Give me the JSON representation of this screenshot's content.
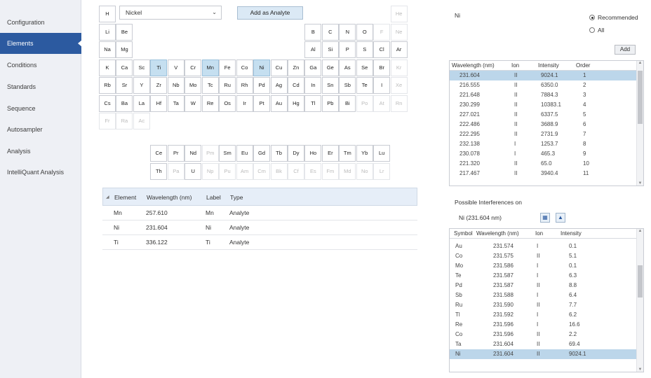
{
  "sidebar": {
    "items": [
      {
        "label": "Configuration",
        "active": false
      },
      {
        "label": "Elements",
        "active": true
      },
      {
        "label": "Conditions",
        "active": false
      },
      {
        "label": "Standards",
        "active": false
      },
      {
        "label": "Sequence",
        "active": false
      },
      {
        "label": "Autosampler",
        "active": false
      },
      {
        "label": "Analysis",
        "active": false
      },
      {
        "label": "IntelliQuant Analysis",
        "active": false
      }
    ]
  },
  "element_picker": {
    "selected": "Nickel",
    "add_button": "Add as Analyte"
  },
  "periodic_table": [
    {
      "s": "H",
      "r": 0,
      "c": 0
    },
    {
      "s": "He",
      "r": 0,
      "c": 17,
      "d": true
    },
    {
      "s": "Li",
      "r": 1,
      "c": 0
    },
    {
      "s": "Be",
      "r": 1,
      "c": 1
    },
    {
      "s": "B",
      "r": 1,
      "c": 12
    },
    {
      "s": "C",
      "r": 1,
      "c": 13
    },
    {
      "s": "N",
      "r": 1,
      "c": 14
    },
    {
      "s": "O",
      "r": 1,
      "c": 15
    },
    {
      "s": "F",
      "r": 1,
      "c": 16,
      "d": true
    },
    {
      "s": "Ne",
      "r": 1,
      "c": 17,
      "d": true
    },
    {
      "s": "Na",
      "r": 2,
      "c": 0
    },
    {
      "s": "Mg",
      "r": 2,
      "c": 1
    },
    {
      "s": "Al",
      "r": 2,
      "c": 12
    },
    {
      "s": "Si",
      "r": 2,
      "c": 13
    },
    {
      "s": "P",
      "r": 2,
      "c": 14
    },
    {
      "s": "S",
      "r": 2,
      "c": 15
    },
    {
      "s": "Cl",
      "r": 2,
      "c": 16
    },
    {
      "s": "Ar",
      "r": 2,
      "c": 17
    },
    {
      "s": "K",
      "r": 3,
      "c": 0
    },
    {
      "s": "Ca",
      "r": 3,
      "c": 1
    },
    {
      "s": "Sc",
      "r": 3,
      "c": 2
    },
    {
      "s": "Ti",
      "r": 3,
      "c": 3,
      "sel": true
    },
    {
      "s": "V",
      "r": 3,
      "c": 4
    },
    {
      "s": "Cr",
      "r": 3,
      "c": 5
    },
    {
      "s": "Mn",
      "r": 3,
      "c": 6,
      "sel": true
    },
    {
      "s": "Fe",
      "r": 3,
      "c": 7
    },
    {
      "s": "Co",
      "r": 3,
      "c": 8
    },
    {
      "s": "Ni",
      "r": 3,
      "c": 9,
      "sel": true
    },
    {
      "s": "Cu",
      "r": 3,
      "c": 10
    },
    {
      "s": "Zn",
      "r": 3,
      "c": 11
    },
    {
      "s": "Ga",
      "r": 3,
      "c": 12
    },
    {
      "s": "Ge",
      "r": 3,
      "c": 13
    },
    {
      "s": "As",
      "r": 3,
      "c": 14
    },
    {
      "s": "Se",
      "r": 3,
      "c": 15
    },
    {
      "s": "Br",
      "r": 3,
      "c": 16
    },
    {
      "s": "Kr",
      "r": 3,
      "c": 17,
      "d": true
    },
    {
      "s": "Rb",
      "r": 4,
      "c": 0
    },
    {
      "s": "Sr",
      "r": 4,
      "c": 1
    },
    {
      "s": "Y",
      "r": 4,
      "c": 2
    },
    {
      "s": "Zr",
      "r": 4,
      "c": 3
    },
    {
      "s": "Nb",
      "r": 4,
      "c": 4
    },
    {
      "s": "Mo",
      "r": 4,
      "c": 5
    },
    {
      "s": "Tc",
      "r": 4,
      "c": 6
    },
    {
      "s": "Ru",
      "r": 4,
      "c": 7
    },
    {
      "s": "Rh",
      "r": 4,
      "c": 8
    },
    {
      "s": "Pd",
      "r": 4,
      "c": 9
    },
    {
      "s": "Ag",
      "r": 4,
      "c": 10
    },
    {
      "s": "Cd",
      "r": 4,
      "c": 11
    },
    {
      "s": "In",
      "r": 4,
      "c": 12
    },
    {
      "s": "Sn",
      "r": 4,
      "c": 13
    },
    {
      "s": "Sb",
      "r": 4,
      "c": 14
    },
    {
      "s": "Te",
      "r": 4,
      "c": 15
    },
    {
      "s": "I",
      "r": 4,
      "c": 16
    },
    {
      "s": "Xe",
      "r": 4,
      "c": 17,
      "d": true
    },
    {
      "s": "Cs",
      "r": 5,
      "c": 0
    },
    {
      "s": "Ba",
      "r": 5,
      "c": 1
    },
    {
      "s": "La",
      "r": 5,
      "c": 2
    },
    {
      "s": "Hf",
      "r": 5,
      "c": 3
    },
    {
      "s": "Ta",
      "r": 5,
      "c": 4
    },
    {
      "s": "W",
      "r": 5,
      "c": 5
    },
    {
      "s": "Re",
      "r": 5,
      "c": 6
    },
    {
      "s": "Os",
      "r": 5,
      "c": 7
    },
    {
      "s": "Ir",
      "r": 5,
      "c": 8
    },
    {
      "s": "Pt",
      "r": 5,
      "c": 9
    },
    {
      "s": "Au",
      "r": 5,
      "c": 10
    },
    {
      "s": "Hg",
      "r": 5,
      "c": 11
    },
    {
      "s": "Tl",
      "r": 5,
      "c": 12
    },
    {
      "s": "Pb",
      "r": 5,
      "c": 13
    },
    {
      "s": "Bi",
      "r": 5,
      "c": 14
    },
    {
      "s": "Po",
      "r": 5,
      "c": 15,
      "d": true
    },
    {
      "s": "At",
      "r": 5,
      "c": 16,
      "d": true
    },
    {
      "s": "Rn",
      "r": 5,
      "c": 17,
      "d": true
    },
    {
      "s": "Fr",
      "r": 6,
      "c": 0,
      "d": true
    },
    {
      "s": "Ra",
      "r": 6,
      "c": 1,
      "d": true
    },
    {
      "s": "Ac",
      "r": 6,
      "c": 2,
      "d": true
    },
    {
      "s": "Ce",
      "r": 7,
      "c": 3
    },
    {
      "s": "Pr",
      "r": 7,
      "c": 4
    },
    {
      "s": "Nd",
      "r": 7,
      "c": 5
    },
    {
      "s": "Pm",
      "r": 7,
      "c": 6,
      "d": true
    },
    {
      "s": "Sm",
      "r": 7,
      "c": 7
    },
    {
      "s": "Eu",
      "r": 7,
      "c": 8
    },
    {
      "s": "Gd",
      "r": 7,
      "c": 9
    },
    {
      "s": "Tb",
      "r": 7,
      "c": 10
    },
    {
      "s": "Dy",
      "r": 7,
      "c": 11
    },
    {
      "s": "Ho",
      "r": 7,
      "c": 12
    },
    {
      "s": "Er",
      "r": 7,
      "c": 13
    },
    {
      "s": "Tm",
      "r": 7,
      "c": 14
    },
    {
      "s": "Yb",
      "r": 7,
      "c": 15
    },
    {
      "s": "Lu",
      "r": 7,
      "c": 16
    },
    {
      "s": "Th",
      "r": 8,
      "c": 3
    },
    {
      "s": "Pa",
      "r": 8,
      "c": 4,
      "d": true
    },
    {
      "s": "U",
      "r": 8,
      "c": 5
    },
    {
      "s": "Np",
      "r": 8,
      "c": 6,
      "d": true
    },
    {
      "s": "Pu",
      "r": 8,
      "c": 7,
      "d": true
    },
    {
      "s": "Am",
      "r": 8,
      "c": 8,
      "d": true
    },
    {
      "s": "Cm",
      "r": 8,
      "c": 9,
      "d": true
    },
    {
      "s": "Bk",
      "r": 8,
      "c": 10,
      "d": true
    },
    {
      "s": "Cf",
      "r": 8,
      "c": 11,
      "d": true
    },
    {
      "s": "Es",
      "r": 8,
      "c": 12,
      "d": true
    },
    {
      "s": "Fm",
      "r": 8,
      "c": 13,
      "d": true
    },
    {
      "s": "Md",
      "r": 8,
      "c": 14,
      "d": true
    },
    {
      "s": "No",
      "r": 8,
      "c": 15,
      "d": true
    },
    {
      "s": "Lr",
      "r": 8,
      "c": 16,
      "d": true
    }
  ],
  "analyte_table": {
    "headers": [
      "Element",
      "Wavelength (nm)",
      "Label",
      "Type"
    ],
    "rows": [
      [
        "Mn",
        "257.610",
        "Mn",
        "Analyte"
      ],
      [
        "Ni",
        "231.604",
        "Ni",
        "Analyte"
      ],
      [
        "Ti",
        "336.122",
        "Ti",
        "Analyte"
      ]
    ]
  },
  "right_panel": {
    "element": "Ni",
    "radio_recommended": "Recommended",
    "radio_all": "All",
    "add_label": "Add",
    "wavelength_table": {
      "headers": [
        "Wavelength (nm)",
        "Ion",
        "Intensity",
        "Order"
      ],
      "rows": [
        [
          "231.604",
          "II",
          "9024.1",
          "1"
        ],
        [
          "216.555",
          "II",
          "6350.0",
          "2"
        ],
        [
          "221.648",
          "II",
          "7884.3",
          "3"
        ],
        [
          "230.299",
          "II",
          "10383.1",
          "4"
        ],
        [
          "227.021",
          "II",
          "6337.5",
          "5"
        ],
        [
          "222.486",
          "II",
          "3688.9",
          "6"
        ],
        [
          "222.295",
          "II",
          "2731.9",
          "7"
        ],
        [
          "232.138",
          "I",
          "1253.7",
          "8"
        ],
        [
          "230.078",
          "I",
          "465.3",
          "9"
        ],
        [
          "221.320",
          "II",
          "65.0",
          "10"
        ],
        [
          "217.467",
          "II",
          "3940.4",
          "11"
        ]
      ],
      "selected_index": 0
    },
    "interferences": {
      "title": "Possible Interferences on",
      "subtitle": "Ni (231.604 nm)",
      "headers": [
        "Symbol",
        "Wavelength (nm)",
        "Ion",
        "Intensity"
      ],
      "rows": [
        [
          "Au",
          "231.574",
          "I",
          "0.1"
        ],
        [
          "Co",
          "231.575",
          "II",
          "5.1"
        ],
        [
          "Mo",
          "231.586",
          "I",
          "0.1"
        ],
        [
          "Te",
          "231.587",
          "I",
          "6.3"
        ],
        [
          "Pd",
          "231.587",
          "II",
          "8.8"
        ],
        [
          "Sb",
          "231.588",
          "I",
          "6.4"
        ],
        [
          "Ru",
          "231.590",
          "II",
          "7.7"
        ],
        [
          "Tl",
          "231.592",
          "I",
          "6.2"
        ],
        [
          "Re",
          "231.596",
          "I",
          "16.6"
        ],
        [
          "Co",
          "231.596",
          "II",
          "2.2"
        ],
        [
          "Ta",
          "231.604",
          "II",
          "69.4"
        ],
        [
          "Ni",
          "231.604",
          "II",
          "9024.1"
        ]
      ],
      "selected_index": 11
    }
  },
  "colors": {
    "sidebar_bg": "#eef0f5",
    "sidebar_active": "#2c5aa0",
    "selection": "#bcd6ea",
    "element_selected": "#c5dff0"
  }
}
